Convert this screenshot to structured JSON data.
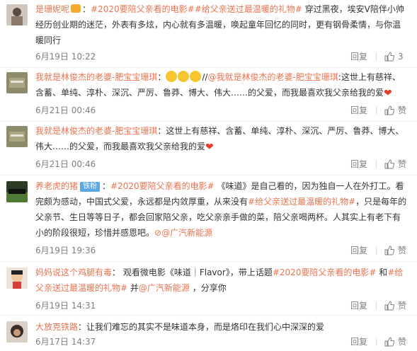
{
  "comments": [
    {
      "user": "是珊妮呢",
      "colon": "：",
      "topic1": "#2020要陪父亲看的电影#",
      "topic2": "#给父亲送过最温暖的礼物#",
      "text": " 穿过黑夜，埃安V陪伴小帅经历创业期的迷茫，外表有多炫，内心就有多温暖，唤起童年回忆的同时，更有钢骨柔情，与你温暖同行",
      "time": "6月19日 10:22",
      "reply": "回复",
      "likes": "3"
    },
    {
      "user": "我就是林俊杰的老婆-肥宝宝珊琪",
      "colon": "：",
      "text_after_emoji": "//",
      "mention": "@我就是林俊杰的老婆-肥宝宝珊琪",
      "text": ":这世上有慈祥、含蓄、单纯、淳朴、深沉、严厉、鲁莽、博大、伟大……的父爱，而我最喜欢我父亲给我的爱",
      "time": "6月21日 00:46",
      "reply": "回复",
      "likes": "赞"
    },
    {
      "user": "我就是林俊杰的老婆-肥宝宝珊琪",
      "colon": "：",
      "text": "这世上有慈祥、含蓄、单纯、淳朴、深沉、严厉、鲁莽、博大、伟大……的父爱，而我最喜欢我父亲给我的爱",
      "time": "6月21日 00:46",
      "reply": "回复",
      "likes": "赞"
    },
    {
      "user": "养老虎的猪",
      "fan_badge": "铁粉",
      "colon": "：",
      "topic1": "#2020要陪父亲看的电影#",
      "text1": " 《味道》是自己看的，因为独自一人在外打工。看完颇为感动，中国式父爱，永远都是内敛厚重，从来没有",
      "topic2": "#给父亲送过最温暖的礼物#",
      "text2": "，只是每年的父亲节、生日等等日子，都会回家陪父亲，吃父亲亲手做的菜，陪父亲喝两杯。人其实上有老下有小的阶段很短，珍惜并感恩吧。",
      "mention": "@广汽新能源",
      "time": "6月19日 19:36",
      "reply": "回复",
      "likes": "赞"
    },
    {
      "user": "妈妈说这个鸡腿有毒",
      "colon": "：",
      "text1": " 观看微电影《味道｜Flavor》，带上话题",
      "topic1": "#2020要陪父亲看的电影#",
      "text2": " 和",
      "topic2": "#给父亲送过最温暖的礼物#",
      "text3": " 并",
      "mention": "@广汽新能源",
      "text4": " ，分享你",
      "time": "6月19日 14:31",
      "reply": "回复",
      "likes": "赞"
    },
    {
      "user": "大放克铁路",
      "colon": "：",
      "text": "让我们难忘的其实不是味道本身，而是烙印在我们心中深深的爱",
      "time": "6月17日 14:37",
      "reply": "回复",
      "likes": "赞"
    }
  ],
  "colors": {
    "accent": "#eb7350",
    "text": "#333333",
    "meta": "#808080",
    "heart": "#e8392b"
  }
}
